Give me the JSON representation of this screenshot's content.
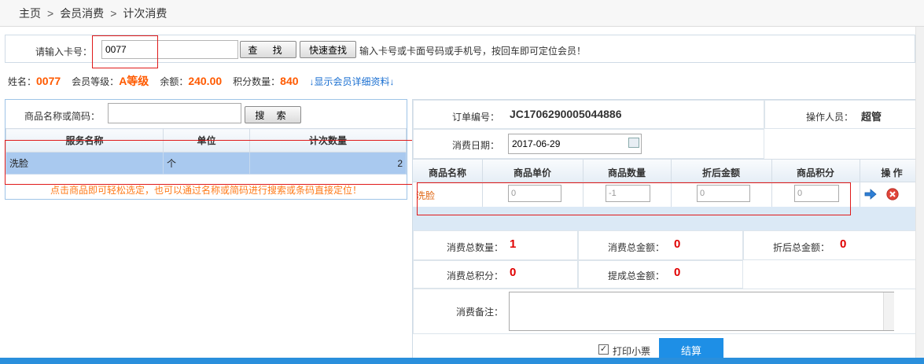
{
  "breadcrumb": [
    "主页",
    "会员消费",
    "计次消费"
  ],
  "card_search": {
    "label": "请输入卡号：",
    "value": "0077",
    "find_label": "查 找",
    "quick_find_label": "快速查找",
    "hint": "输入卡号或卡面号码或手机号，按回车即可定位会员！"
  },
  "member": {
    "name_label": "姓名：",
    "name": "0077",
    "level_label": "会员等级：",
    "level": "A等级",
    "balance_label": "余额：",
    "balance": "240.00",
    "points_label": "积分数量：",
    "points": "840",
    "detail_link": "↓显示会员详细资料↓"
  },
  "goods_search": {
    "label": "商品名称或简码：",
    "value": "",
    "search_label": "搜 索"
  },
  "service_table": {
    "columns": [
      "服务名称",
      "单位",
      "计次数量"
    ],
    "rows": [
      {
        "name": "洗脸",
        "unit": "个",
        "count": "2"
      }
    ],
    "hint": "点击商品即可轻松选定，也可以通过名称或简码进行搜索或条码直接定位！"
  },
  "order": {
    "order_no_label": "订单编号：",
    "order_no": "JC1706290005044886",
    "operator_label": "操作人员：",
    "operator": "超管",
    "date_label": "消费日期：",
    "date": "2017-06-29"
  },
  "goods_table": {
    "columns": [
      "商品名称",
      "商品单价",
      "商品数量",
      "折后金额",
      "商品积分",
      "操 作"
    ],
    "row": {
      "name": "洗脸",
      "price": "0",
      "qty": "-1",
      "discount": "0",
      "points": "0"
    }
  },
  "totals": {
    "total_qty_label": "消费总数量：",
    "total_qty": "1",
    "total_amount_label": "消费总金额：",
    "total_amount": "0",
    "discount_total_label": "折后总金额：",
    "discount_total": "0",
    "total_points_label": "消费总积分：",
    "total_points": "0",
    "commission_label": "提成总金额：",
    "commission": "0",
    "remark_label": "消费备注："
  },
  "footer": {
    "print_label": "打印小票",
    "print_checked": "✓",
    "settle_label": "结算"
  },
  "colors": {
    "accent": "#1e8fe6",
    "orange": "#ff5a00",
    "red": "#e00000",
    "highlight": "#e01a1a"
  }
}
